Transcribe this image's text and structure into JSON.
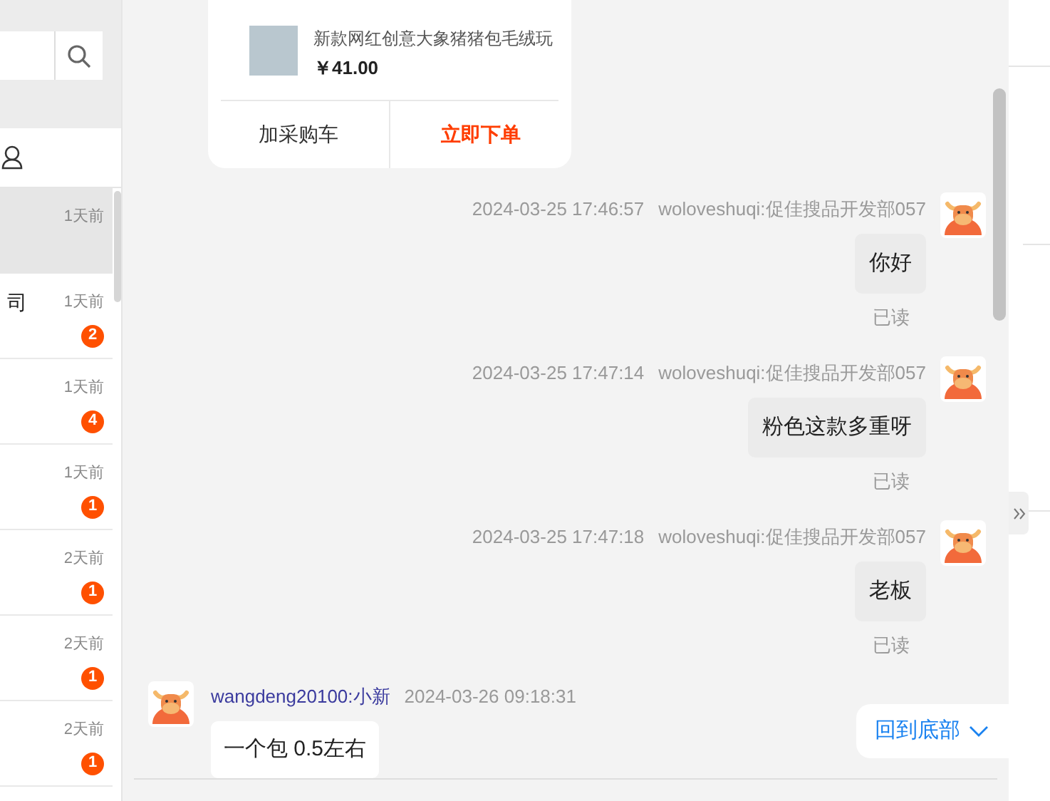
{
  "sidebar": {
    "conversations": [
      {
        "time": "1天前",
        "selected": true
      },
      {
        "name_fragment": "司",
        "time": "1天前",
        "unread": "2",
        "selected": false
      },
      {
        "time": "1天前",
        "unread": "4",
        "selected": false
      },
      {
        "time": "1天前",
        "unread": "1",
        "selected": false
      },
      {
        "time": "2天前",
        "unread": "1",
        "selected": false
      },
      {
        "time": "2天前",
        "unread": "1",
        "selected": false
      },
      {
        "time": "2天前",
        "unread": "1",
        "selected": false
      }
    ]
  },
  "product_card": {
    "name": "新款网红创意大象猪猪包毛绒玩",
    "price": "￥41.00",
    "buttons": [
      {
        "label": "加采购车",
        "kind": "plain"
      },
      {
        "label": "立即下单",
        "kind": "primary"
      }
    ]
  },
  "messages": [
    {
      "kind": "outgoing",
      "time": "2024-03-25 17:46:57",
      "sender": "woloveshuqi:促佳搜品开发部057",
      "text": "你好",
      "status": "已读"
    },
    {
      "kind": "outgoing",
      "time": "2024-03-25 17:47:14",
      "sender": "woloveshuqi:促佳搜品开发部057",
      "text": "粉色这款多重呀",
      "status": "已读"
    },
    {
      "kind": "outgoing",
      "time": "2024-03-25 17:47:18",
      "sender": "woloveshuqi:促佳搜品开发部057",
      "text": "老板",
      "status": "已读"
    },
    {
      "kind": "incoming",
      "time": "2024-03-26 09:18:31",
      "sender": "wangdeng20100:小新",
      "text": "一个包 0.5左右"
    }
  ],
  "back_to_bottom": "回到底部"
}
